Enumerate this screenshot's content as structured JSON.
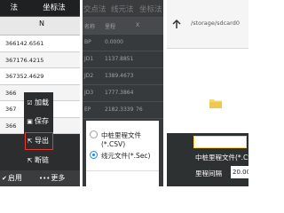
{
  "panel1": {
    "tabs": [
      "法",
      "坐标法"
    ],
    "column_header": "N",
    "rows": [
      "366142.6561",
      "367176.4215",
      "367352.4629",
      "366",
      "367",
      "366"
    ],
    "menu": [
      {
        "icon": "load-icon",
        "label": "加载"
      },
      {
        "icon": "save-icon",
        "label": "保存"
      },
      {
        "icon": "export-icon",
        "label": "导出"
      },
      {
        "icon": "break-chain-icon",
        "label": "断链"
      }
    ],
    "bottom": {
      "enable_label": "启用",
      "more_label": "更多"
    }
  },
  "panel2": {
    "tabs": [
      "交点法",
      "线元法",
      "坐标法"
    ],
    "grid_header": [
      "名称",
      "里程",
      "X"
    ],
    "grid_rows": [
      [
        "BP",
        "0.0000",
        ""
      ],
      [
        "JD1",
        "1137.8851",
        ""
      ],
      [
        "JD2",
        "1389.4673",
        ""
      ],
      [
        "JD3",
        "1777.3864",
        ""
      ],
      [
        "EP",
        "2182.3339",
        "76"
      ]
    ],
    "dialog_options": [
      {
        "label": "中桩里程文件(*.CSV)",
        "selected": false
      },
      {
        "label": "线元文件(*.Sec)",
        "selected": true
      }
    ]
  },
  "panel3": {
    "path": "/storage/sdcard0",
    "format_label": "中桩里程文件(*.CSV",
    "interval_label": "里程间隔",
    "interval_value": "20.000"
  }
}
